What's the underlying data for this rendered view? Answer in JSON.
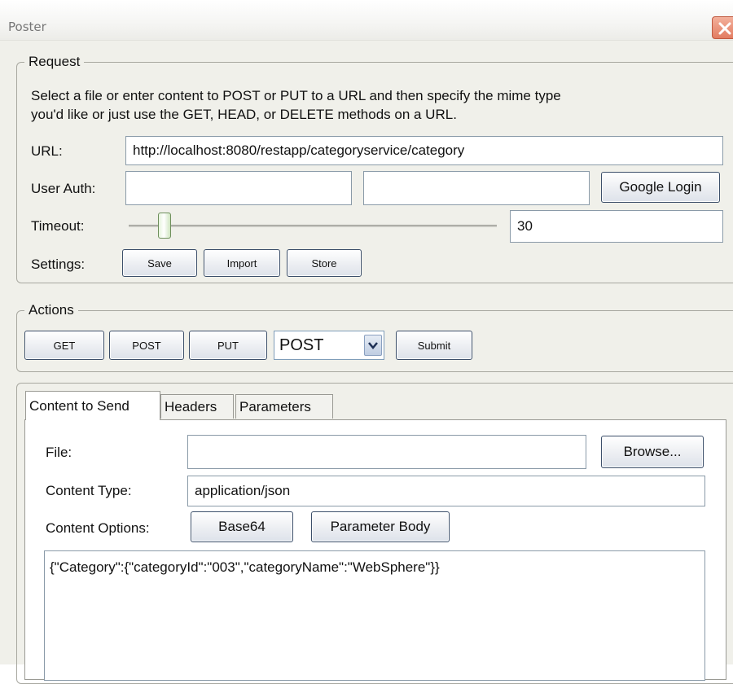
{
  "window": {
    "title": "Poster"
  },
  "request": {
    "legend": "Request",
    "description_line1": "Select a file or enter content to POST or PUT to a URL and then specify the mime type",
    "description_line2": "you'd like or just use the GET, HEAD, or DELETE methods on a URL.",
    "url_label": "URL:",
    "url_value": "http://localhost:8080/restapp/categoryservice/category",
    "user_auth_label": "User Auth:",
    "username_value": "",
    "password_value": "",
    "google_login_label": "Google Login",
    "timeout_label": "Timeout:",
    "timeout_value": "30",
    "settings_label": "Settings:",
    "save_label": "Save",
    "import_label": "Import",
    "store_label": "Store"
  },
  "actions": {
    "legend": "Actions",
    "get_label": "GET",
    "post_label": "POST",
    "put_label": "PUT",
    "method_selected": "POST",
    "submit_label": "Submit"
  },
  "tabs": [
    {
      "label": "Content to Send",
      "active": true
    },
    {
      "label": "Headers",
      "active": false
    },
    {
      "label": "Parameters",
      "active": false
    }
  ],
  "content": {
    "file_label": "File:",
    "file_value": "",
    "browse_label": "Browse...",
    "content_type_label": "Content Type:",
    "content_type_value": "application/json",
    "content_options_label": "Content Options:",
    "base64_label": "Base64",
    "parameter_body_label": "Parameter Body",
    "body_text": "{\"Category\":{\"categoryId\":\"003\",\"categoryName\":\"WebSphere\"}}"
  }
}
